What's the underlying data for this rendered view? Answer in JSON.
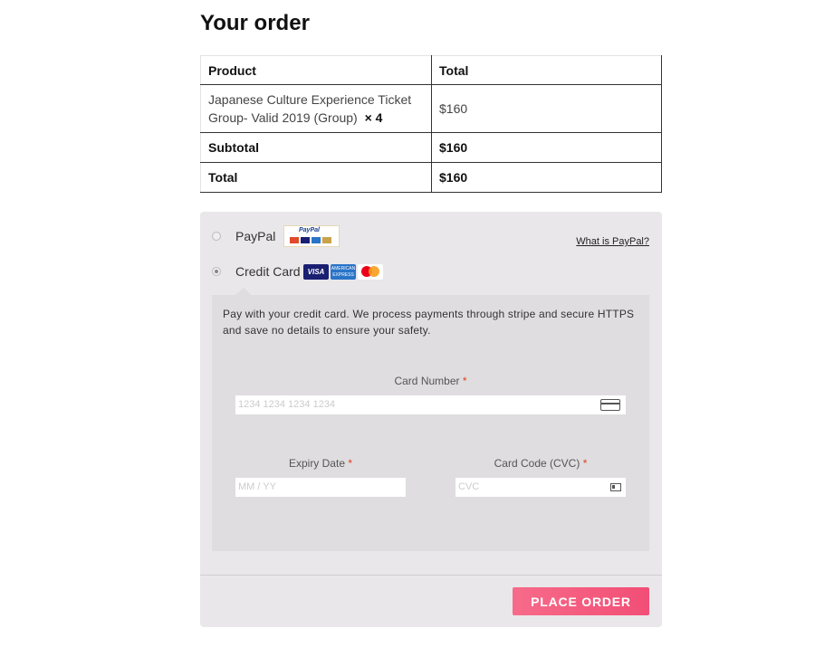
{
  "page_title": "Your order",
  "order_table": {
    "headers": [
      "Product",
      "Total"
    ],
    "item": {
      "name_line1": "Japanese Culture Experience Ticket",
      "name_line2": "Group- Valid 2019 (Group)",
      "qty": "× 4",
      "total": "$160"
    },
    "subtotal": {
      "label": "Subtotal",
      "value": "$160"
    },
    "total": {
      "label": "Total",
      "value": "$160"
    }
  },
  "payment": {
    "paypal": {
      "label": "PayPal",
      "badge_text": "PayPal",
      "link": "What is PayPal?",
      "selected": false
    },
    "credit_card": {
      "label": "Credit Card",
      "selected": true,
      "logos": [
        "visa-logo",
        "amex-logo",
        "mastercard-logo"
      ],
      "visa_text": "VISA",
      "amex_text": "AMERICAN EXPRESS",
      "description": "Pay with your credit card. We process payments through stripe and secure HTTPS and save no details to ensure your safety.",
      "card_number": {
        "label": "Card Number",
        "required": "*",
        "placeholder": "1234 1234 1234 1234"
      },
      "expiry": {
        "label": "Expiry Date",
        "required": "*",
        "placeholder": "MM / YY"
      },
      "cvc": {
        "label": "Card Code (CVC)",
        "required": "*",
        "placeholder": "CVC"
      }
    },
    "place_order_label": "PLACE ORDER",
    "colors": {
      "button_start": "#f76b8a",
      "button_end": "#f24e76",
      "panel": "#e9e7ea",
      "required": "#e2401c"
    }
  }
}
